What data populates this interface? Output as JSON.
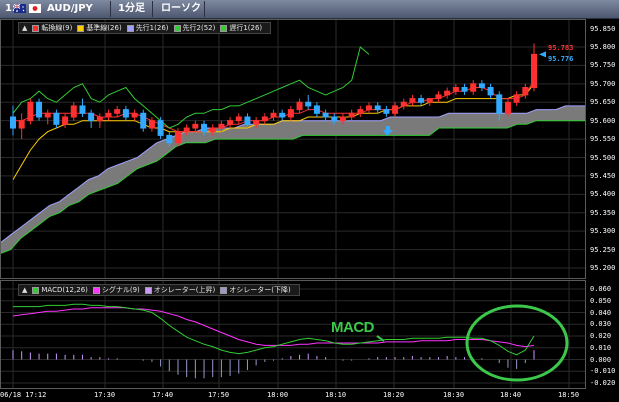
{
  "titlebar": {
    "index": "1:",
    "symbol": "AUD/JPY",
    "timeframe": "1分足",
    "chart_style": "ローソク"
  },
  "legend_main": {
    "items": [
      {
        "label": "転換線(9)",
        "color": "#ff3030"
      },
      {
        "label": "基準線(26)",
        "color": "#ffcc00"
      },
      {
        "label": "先行1(26)",
        "color": "#a0a0ff"
      },
      {
        "label": "先行2(52)",
        "color": "#33cc33"
      },
      {
        "label": "遅行1(26)",
        "color": "#33cc33"
      }
    ]
  },
  "legend_macd": {
    "items": [
      {
        "label": "MACD(12,26)",
        "color": "#33cc33"
      },
      {
        "label": "シグナル(9)",
        "color": "#ff33ff"
      },
      {
        "label": "オシレーター(上昇)",
        "color": "#cc99ff"
      },
      {
        "label": "オシレーター(下降)",
        "color": "#9999cc"
      }
    ]
  },
  "price_labels": {
    "high": "95.783",
    "current": "95.776"
  },
  "annotation": {
    "text": "MACD",
    "color": "#3cc84a"
  },
  "chart_data": [
    {
      "type": "candlestick",
      "title": "AUD/JPY 1分足",
      "ylim": [
        95.17,
        95.82
      ],
      "yticks": [
        "95.850",
        "95.800",
        "95.750",
        "95.700",
        "95.650",
        "95.600",
        "95.550",
        "95.500",
        "95.450",
        "95.400",
        "95.350",
        "95.300",
        "95.250",
        "95.200"
      ],
      "candles": [
        {
          "o": 95.61,
          "h": 95.64,
          "l": 95.56,
          "c": 95.58
        },
        {
          "o": 95.58,
          "h": 95.62,
          "l": 95.55,
          "c": 95.6
        },
        {
          "o": 95.6,
          "h": 95.66,
          "l": 95.59,
          "c": 95.65
        },
        {
          "o": 95.65,
          "h": 95.66,
          "l": 95.6,
          "c": 95.61
        },
        {
          "o": 95.61,
          "h": 95.63,
          "l": 95.59,
          "c": 95.62
        },
        {
          "o": 95.62,
          "h": 95.63,
          "l": 95.58,
          "c": 95.59
        },
        {
          "o": 95.59,
          "h": 95.62,
          "l": 95.58,
          "c": 95.61
        },
        {
          "o": 95.61,
          "h": 95.65,
          "l": 95.6,
          "c": 95.64
        },
        {
          "o": 95.64,
          "h": 95.66,
          "l": 95.61,
          "c": 95.62
        },
        {
          "o": 95.62,
          "h": 95.63,
          "l": 95.58,
          "c": 95.6
        },
        {
          "o": 95.6,
          "h": 95.62,
          "l": 95.58,
          "c": 95.61
        },
        {
          "o": 95.61,
          "h": 95.63,
          "l": 95.6,
          "c": 95.62
        },
        {
          "o": 95.62,
          "h": 95.64,
          "l": 95.61,
          "c": 95.63
        },
        {
          "o": 95.63,
          "h": 95.64,
          "l": 95.6,
          "c": 95.61
        },
        {
          "o": 95.61,
          "h": 95.63,
          "l": 95.6,
          "c": 95.62
        },
        {
          "o": 95.62,
          "h": 95.63,
          "l": 95.57,
          "c": 95.58
        },
        {
          "o": 95.58,
          "h": 95.61,
          "l": 95.57,
          "c": 95.6
        },
        {
          "o": 95.6,
          "h": 95.61,
          "l": 95.55,
          "c": 95.56
        },
        {
          "o": 95.56,
          "h": 95.57,
          "l": 95.53,
          "c": 95.54
        },
        {
          "o": 95.54,
          "h": 95.58,
          "l": 95.53,
          "c": 95.57
        },
        {
          "o": 95.57,
          "h": 95.59,
          "l": 95.56,
          "c": 95.58
        },
        {
          "o": 95.58,
          "h": 95.6,
          "l": 95.57,
          "c": 95.59
        },
        {
          "o": 95.59,
          "h": 95.6,
          "l": 95.56,
          "c": 95.57
        },
        {
          "o": 95.57,
          "h": 95.59,
          "l": 95.56,
          "c": 95.58
        },
        {
          "o": 95.58,
          "h": 95.6,
          "l": 95.57,
          "c": 95.59
        },
        {
          "o": 95.59,
          "h": 95.61,
          "l": 95.58,
          "c": 95.6
        },
        {
          "o": 95.6,
          "h": 95.62,
          "l": 95.59,
          "c": 95.61
        },
        {
          "o": 95.61,
          "h": 95.62,
          "l": 95.58,
          "c": 95.59
        },
        {
          "o": 95.59,
          "h": 95.61,
          "l": 95.58,
          "c": 95.6
        },
        {
          "o": 95.6,
          "h": 95.62,
          "l": 95.59,
          "c": 95.61
        },
        {
          "o": 95.61,
          "h": 95.63,
          "l": 95.6,
          "c": 95.62
        },
        {
          "o": 95.62,
          "h": 95.63,
          "l": 95.6,
          "c": 95.61
        },
        {
          "o": 95.61,
          "h": 95.64,
          "l": 95.6,
          "c": 95.63
        },
        {
          "o": 95.63,
          "h": 95.66,
          "l": 95.62,
          "c": 95.65
        },
        {
          "o": 95.65,
          "h": 95.67,
          "l": 95.63,
          "c": 95.64
        },
        {
          "o": 95.64,
          "h": 95.65,
          "l": 95.61,
          "c": 95.62
        },
        {
          "o": 95.62,
          "h": 95.63,
          "l": 95.6,
          "c": 95.61
        },
        {
          "o": 95.61,
          "h": 95.62,
          "l": 95.59,
          "c": 95.6
        },
        {
          "o": 95.6,
          "h": 95.62,
          "l": 95.59,
          "c": 95.61
        },
        {
          "o": 95.61,
          "h": 95.63,
          "l": 95.6,
          "c": 95.62
        },
        {
          "o": 95.62,
          "h": 95.64,
          "l": 95.61,
          "c": 95.63
        },
        {
          "o": 95.63,
          "h": 95.65,
          "l": 95.62,
          "c": 95.64
        },
        {
          "o": 95.64,
          "h": 95.65,
          "l": 95.62,
          "c": 95.63
        },
        {
          "o": 95.63,
          "h": 95.64,
          "l": 95.61,
          "c": 95.62
        },
        {
          "o": 95.62,
          "h": 95.65,
          "l": 95.61,
          "c": 95.64
        },
        {
          "o": 95.64,
          "h": 95.66,
          "l": 95.63,
          "c": 95.65
        },
        {
          "o": 95.65,
          "h": 95.67,
          "l": 95.64,
          "c": 95.66
        },
        {
          "o": 95.66,
          "h": 95.67,
          "l": 95.64,
          "c": 95.65
        },
        {
          "o": 95.65,
          "h": 95.66,
          "l": 95.64,
          "c": 95.66
        },
        {
          "o": 95.66,
          "h": 95.68,
          "l": 95.65,
          "c": 95.67
        },
        {
          "o": 95.67,
          "h": 95.69,
          "l": 95.66,
          "c": 95.68
        },
        {
          "o": 95.68,
          "h": 95.7,
          "l": 95.67,
          "c": 95.69
        },
        {
          "o": 95.69,
          "h": 95.7,
          "l": 95.67,
          "c": 95.68
        },
        {
          "o": 95.68,
          "h": 95.71,
          "l": 95.67,
          "c": 95.7
        },
        {
          "o": 95.7,
          "h": 95.71,
          "l": 95.68,
          "c": 95.69
        },
        {
          "o": 95.69,
          "h": 95.7,
          "l": 95.66,
          "c": 95.67
        },
        {
          "o": 95.67,
          "h": 95.68,
          "l": 95.6,
          "c": 95.62
        },
        {
          "o": 95.62,
          "h": 95.66,
          "l": 95.61,
          "c": 95.65
        },
        {
          "o": 95.65,
          "h": 95.68,
          "l": 95.64,
          "c": 95.67
        },
        {
          "o": 95.67,
          "h": 95.7,
          "l": 95.66,
          "c": 95.69
        },
        {
          "o": 95.69,
          "h": 95.81,
          "l": 95.68,
          "c": 95.78
        }
      ],
      "tenkan": [
        95.6,
        95.6,
        95.61,
        95.62,
        95.62,
        95.62,
        95.62,
        95.62,
        95.62,
        95.62,
        95.61,
        95.61,
        95.61,
        95.62,
        95.62,
        95.61,
        95.6,
        95.59,
        95.58,
        95.57,
        95.57,
        95.57,
        95.57,
        95.58,
        95.58,
        95.59,
        95.59,
        95.6,
        95.6,
        95.6,
        95.61,
        95.61,
        95.62,
        95.62,
        95.63,
        95.63,
        95.62,
        95.62,
        95.62,
        95.62,
        95.62,
        95.63,
        95.63,
        95.63,
        95.63,
        95.64,
        95.65,
        95.65,
        95.66,
        95.66,
        95.67,
        95.68,
        95.68,
        95.69,
        95.69,
        95.68,
        95.66,
        95.66,
        95.66,
        95.67,
        95.71
      ],
      "kijun": [
        95.44,
        95.48,
        95.52,
        95.55,
        95.57,
        95.58,
        95.59,
        95.59,
        95.6,
        95.6,
        95.6,
        95.6,
        95.6,
        95.6,
        95.6,
        95.59,
        95.58,
        95.58,
        95.57,
        95.57,
        95.57,
        95.57,
        95.57,
        95.57,
        95.57,
        95.58,
        95.58,
        95.58,
        95.59,
        95.59,
        95.59,
        95.6,
        95.6,
        95.6,
        95.61,
        95.61,
        95.61,
        95.61,
        95.61,
        95.61,
        95.62,
        95.62,
        95.62,
        95.63,
        95.63,
        95.64,
        95.64,
        95.64,
        95.65,
        95.65,
        95.65,
        95.66,
        95.66,
        95.66,
        95.66,
        95.66,
        95.66,
        95.66,
        95.67,
        95.67,
        95.7
      ],
      "senkou1": [
        95.27,
        95.29,
        95.31,
        95.33,
        95.35,
        95.37,
        95.38,
        95.4,
        95.42,
        95.44,
        95.45,
        95.47,
        95.48,
        95.49,
        95.5,
        95.52,
        95.54,
        95.55,
        95.56,
        95.57,
        95.57,
        95.58,
        95.58,
        95.58,
        95.58,
        95.59,
        95.59,
        95.59,
        95.59,
        95.6,
        95.6,
        95.6,
        95.6,
        95.6,
        95.6,
        95.6,
        95.6,
        95.6,
        95.6,
        95.6,
        95.61,
        95.61,
        95.61,
        95.61,
        95.61,
        95.61,
        95.62,
        95.62,
        95.62,
        95.62,
        95.62,
        95.62,
        95.62,
        95.62,
        95.62,
        95.63,
        95.63,
        95.63,
        95.64,
        95.64,
        95.64
      ],
      "senkou2": [
        95.24,
        95.25,
        95.28,
        95.3,
        95.32,
        95.34,
        95.35,
        95.37,
        95.38,
        95.4,
        95.41,
        95.42,
        95.43,
        95.45,
        95.47,
        95.48,
        95.49,
        95.51,
        95.53,
        95.54,
        95.54,
        95.54,
        95.55,
        95.55,
        95.55,
        95.55,
        95.55,
        95.55,
        95.55,
        95.55,
        95.55,
        95.56,
        95.56,
        95.56,
        95.56,
        95.56,
        95.56,
        95.56,
        95.56,
        95.56,
        95.56,
        95.56,
        95.56,
        95.56,
        95.56,
        95.58,
        95.58,
        95.58,
        95.58,
        95.58,
        95.58,
        95.58,
        95.58,
        95.59,
        95.59,
        95.6,
        95.6,
        95.6,
        95.6,
        95.6,
        95.6
      ],
      "chikou": [
        95.62,
        95.65,
        95.66,
        95.68,
        95.66,
        95.65,
        95.67,
        95.69,
        95.7,
        95.66,
        95.65,
        95.67,
        95.68,
        95.69,
        95.66,
        95.64,
        95.62,
        95.6,
        95.58,
        95.59,
        95.61,
        95.62,
        95.62,
        95.63,
        95.63,
        95.64,
        95.64,
        95.65,
        95.66,
        95.67,
        95.68,
        95.69,
        95.7,
        95.71,
        95.69,
        95.68,
        95.67,
        95.68,
        95.69,
        95.71,
        95.8,
        95.78
      ]
    },
    {
      "type": "line",
      "title": "MACD",
      "ylim": [
        -0.012,
        0.062
      ],
      "yticks": [
        "0.060",
        "0.050",
        "0.040",
        "0.030",
        "0.020",
        "0.010",
        "0.000",
        "-0.010",
        "-0.020"
      ],
      "macd": [
        0.045,
        0.045,
        0.045,
        0.045,
        0.046,
        0.046,
        0.046,
        0.047,
        0.047,
        0.046,
        0.046,
        0.045,
        0.045,
        0.044,
        0.043,
        0.042,
        0.04,
        0.035,
        0.029,
        0.024,
        0.019,
        0.016,
        0.013,
        0.011,
        0.008,
        0.006,
        0.005,
        0.006,
        0.008,
        0.01,
        0.011,
        0.013,
        0.015,
        0.017,
        0.018,
        0.017,
        0.016,
        0.014,
        0.013,
        0.013,
        0.014,
        0.015,
        0.016,
        0.017,
        0.017,
        0.017,
        0.018,
        0.018,
        0.018,
        0.018,
        0.019,
        0.019,
        0.019,
        0.018,
        0.018,
        0.016,
        0.012,
        0.007,
        0.004,
        0.008,
        0.02
      ],
      "signal": [
        0.037,
        0.038,
        0.039,
        0.04,
        0.041,
        0.041,
        0.042,
        0.043,
        0.043,
        0.044,
        0.044,
        0.044,
        0.044,
        0.044,
        0.043,
        0.043,
        0.042,
        0.041,
        0.039,
        0.037,
        0.034,
        0.032,
        0.029,
        0.026,
        0.023,
        0.02,
        0.017,
        0.015,
        0.013,
        0.012,
        0.012,
        0.012,
        0.012,
        0.013,
        0.013,
        0.014,
        0.014,
        0.014,
        0.014,
        0.014,
        0.014,
        0.014,
        0.014,
        0.015,
        0.015,
        0.015,
        0.015,
        0.016,
        0.016,
        0.016,
        0.016,
        0.017,
        0.017,
        0.017,
        0.017,
        0.016,
        0.015,
        0.014,
        0.012,
        0.011,
        0.012
      ],
      "histogram": [
        0.008,
        0.007,
        0.006,
        0.005,
        0.005,
        0.005,
        0.004,
        0.004,
        0.004,
        0.002,
        0.002,
        0.001,
        0.001,
        0.0,
        0.0,
        -0.001,
        -0.002,
        -0.006,
        -0.01,
        -0.013,
        -0.015,
        -0.016,
        -0.016,
        -0.015,
        -0.015,
        -0.014,
        -0.012,
        -0.009,
        -0.005,
        -0.002,
        -0.001,
        0.001,
        0.003,
        0.004,
        0.005,
        0.003,
        0.002,
        0.0,
        -0.001,
        -0.001,
        0.0,
        0.001,
        0.002,
        0.002,
        0.002,
        0.002,
        0.003,
        0.002,
        0.002,
        0.002,
        0.003,
        0.002,
        0.002,
        0.001,
        0.001,
        0.0,
        -0.003,
        -0.007,
        -0.008,
        -0.003,
        0.008
      ]
    }
  ],
  "xaxis": {
    "ticks": [
      "06/18 17:12",
      "17:30",
      "17:40",
      "17:50",
      "18:00",
      "18:10",
      "18:20",
      "18:30",
      "18:40",
      "18:50"
    ]
  }
}
